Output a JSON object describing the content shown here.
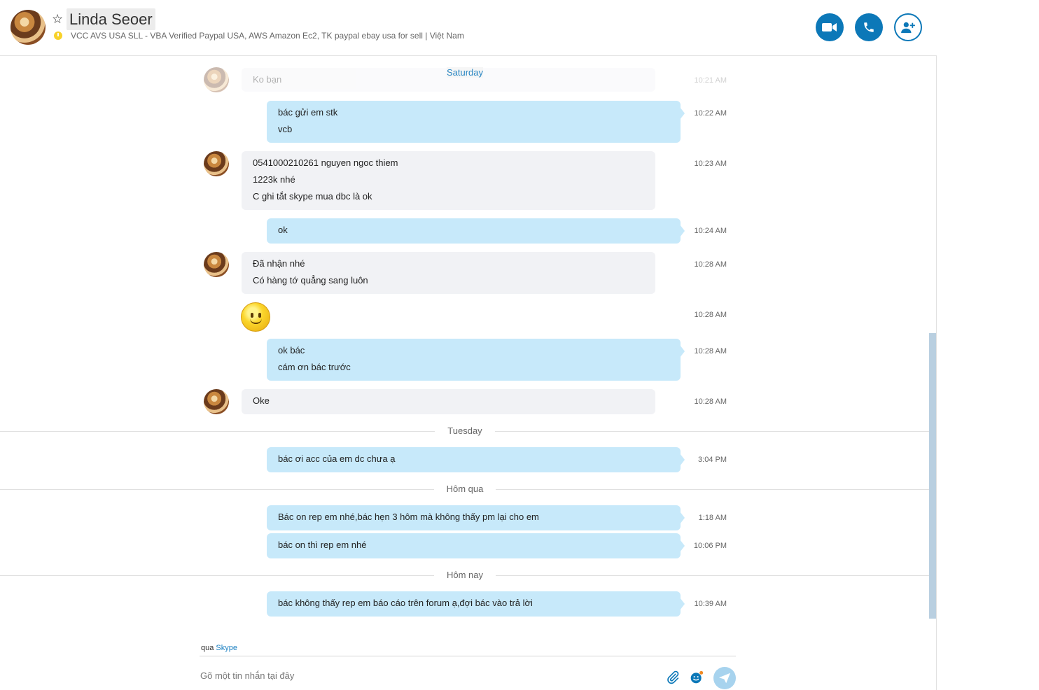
{
  "header": {
    "contact_name": "Linda Seoer",
    "mood_message": "VCC AVS USA SLL - VBA Verified Paypal USA, AWS Amazon Ec2, TK paypal ebay usa for sell  |  Việt Nam",
    "video_call_label": "video-icon",
    "audio_call_label": "phone-icon",
    "add_people_label": "add-person-icon"
  },
  "dates": {
    "saturday": "Saturday",
    "tuesday": "Tuesday",
    "yesterday": "Hôm qua",
    "today": "Hôm nay"
  },
  "messages": [
    {
      "id": "m0",
      "dir": "in",
      "lines": [
        "Ko bạn"
      ],
      "time": "10:21 AM"
    },
    {
      "id": "m1",
      "dir": "out",
      "lines": [
        "bác gửi em stk",
        "vcb"
      ],
      "time": "10:22 AM"
    },
    {
      "id": "m2",
      "dir": "in",
      "lines": [
        "0541000210261 nguyen ngoc thiem",
        "1223k nhé",
        "C ghi tắt skype mua dbc là ok"
      ],
      "time": "10:23 AM"
    },
    {
      "id": "m3",
      "dir": "out",
      "lines": [
        "ok"
      ],
      "time": "10:24 AM"
    },
    {
      "id": "m4",
      "dir": "in",
      "lines": [
        "Đã nhận nhé",
        "Có hàng tớ quẳng sang luôn"
      ],
      "time": "10:28 AM"
    },
    {
      "id": "m5",
      "dir": "in",
      "emoji": "smile-emoticon",
      "time": "10:28 AM"
    },
    {
      "id": "m6",
      "dir": "out",
      "lines": [
        "ok bác",
        "cám ơn bác trước"
      ],
      "time": "10:28 AM"
    },
    {
      "id": "m7",
      "dir": "in",
      "lines": [
        "Oke"
      ],
      "time": "10:28 AM"
    },
    {
      "id": "m8",
      "dir": "out",
      "lines": [
        "bác ơi acc của em dc chưa ạ"
      ],
      "time": "3:04 PM"
    },
    {
      "id": "m9",
      "dir": "out",
      "lines": [
        "Bác on rep em nhé,bác hẹn 3 hôm mà không thấy pm lại cho em"
      ],
      "time": "1:18 AM"
    },
    {
      "id": "m10",
      "dir": "out",
      "lines": [
        "bác on thì rep em nhé"
      ],
      "time": "10:06 PM"
    },
    {
      "id": "m11",
      "dir": "out",
      "lines": [
        "bác không thấy rep em báo cáo trên forum ạ,đợi bác vào trả lời"
      ],
      "time": "10:39 AM"
    }
  ],
  "footer": {
    "via_prefix": "qua",
    "via_service": "Skype",
    "compose_placeholder": "Gõ một tin nhắn tại đây"
  },
  "colors": {
    "accent": "#0c78b8",
    "outgoing_bubble": "#c7e9fa",
    "incoming_bubble": "#f1f2f5",
    "status_away": "#f8d22a"
  }
}
